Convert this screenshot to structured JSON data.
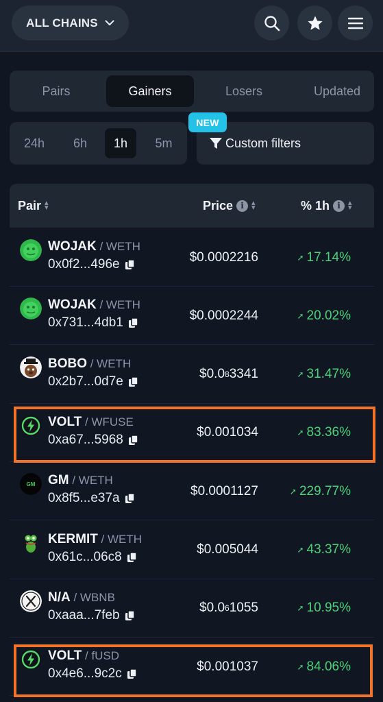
{
  "header": {
    "chain_selector": "ALL CHAINS",
    "icons": [
      "search-icon",
      "star-icon",
      "menu-icon"
    ]
  },
  "tabs": [
    {
      "label": "Pairs",
      "active": false
    },
    {
      "label": "Gainers",
      "active": true
    },
    {
      "label": "Losers",
      "active": false
    },
    {
      "label": "Updated",
      "active": false
    }
  ],
  "timeframes": [
    {
      "label": "24h",
      "active": false
    },
    {
      "label": "6h",
      "active": false
    },
    {
      "label": "1h",
      "active": true
    },
    {
      "label": "5m",
      "active": false
    }
  ],
  "filters": {
    "label": "Custom filters",
    "badge": "NEW"
  },
  "table": {
    "columns": {
      "pair": "Pair",
      "price": "Price",
      "change": "% 1h"
    },
    "rows": [
      {
        "symbol": "WOJAK",
        "quote": "WETH",
        "address": "0x0f2...496e",
        "price": "$0.0002216",
        "change": "17.14%",
        "avatar": "wojak-avatar",
        "highlighted": false
      },
      {
        "symbol": "WOJAK",
        "quote": "WETH",
        "address": "0x731...4db1",
        "price": "$0.0002244",
        "change": "20.02%",
        "avatar": "wojak-avatar",
        "highlighted": false
      },
      {
        "symbol": "BOBO",
        "quote": "WETH",
        "address": "0x2b7...0d7e",
        "price_prefix": "$0.0",
        "price_sub": "8",
        "price_rest": "3341",
        "change": "31.47%",
        "avatar": "bobo-avatar",
        "highlighted": false
      },
      {
        "symbol": "VOLT",
        "quote": "WFUSE",
        "address": "0xa67...5968",
        "price": "$0.001034",
        "change": "83.36%",
        "avatar": "volt-avatar",
        "highlighted": true
      },
      {
        "symbol": "GM",
        "quote": "WETH",
        "address": "0x8f5...e37a",
        "price": "$0.0001127",
        "change": "229.77%",
        "avatar": "gm-avatar",
        "highlighted": false
      },
      {
        "symbol": "KERMIT",
        "quote": "WETH",
        "address": "0x61c...06c8",
        "price": "$0.005044",
        "change": "43.37%",
        "avatar": "kermit-avatar",
        "highlighted": false
      },
      {
        "symbol": "N/A",
        "quote": "WBNB",
        "address": "0xaaa...7feb",
        "price_prefix": "$0.0",
        "price_sub": "6",
        "price_rest": "1055",
        "change": "10.95%",
        "avatar": "x-avatar",
        "highlighted": false
      },
      {
        "symbol": "VOLT",
        "quote": "fUSD",
        "address": "0x4e6...9c2c",
        "price": "$0.001037",
        "change": "84.06%",
        "avatar": "volt-avatar",
        "highlighted": true
      }
    ]
  }
}
